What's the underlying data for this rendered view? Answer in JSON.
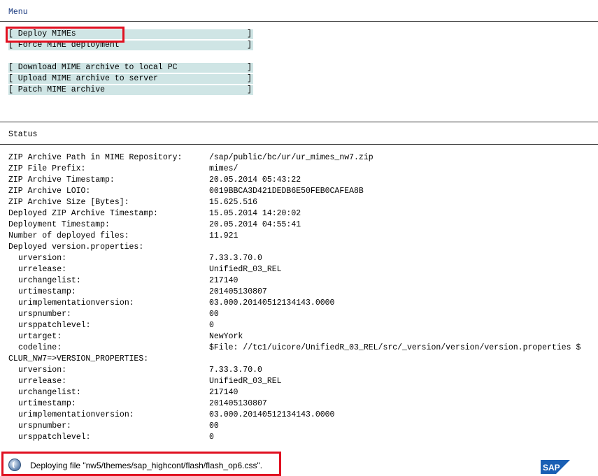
{
  "menu": {
    "title": "Menu",
    "items": [
      {
        "label": "[ Deploy MIMEs",
        "bracket": "]"
      },
      {
        "label": "[ Force MIME deployment",
        "bracket": "]"
      },
      {
        "label": "[ Download MIME archive to local PC",
        "bracket": "]"
      },
      {
        "label": "[ Upload MIME archive to server",
        "bracket": "]"
      },
      {
        "label": "[ Patch MIME archive",
        "bracket": "]"
      }
    ]
  },
  "status": {
    "title": "Status",
    "rows": [
      {
        "key": "ZIP Archive Path in MIME Repository:",
        "value": "/sap/public/bc/ur/ur_mimes_nw7.zip"
      },
      {
        "key": "ZIP File Prefix:",
        "value": "mimes/"
      },
      {
        "key": "ZIP Archive Timestamp:",
        "value": "20.05.2014 05:43:22"
      },
      {
        "key": "ZIP Archive LOIO:",
        "value": "0019BBCA3D421DEDB6E50FEB0CAFEA8B"
      },
      {
        "key": "ZIP Archive Size [Bytes]:",
        "value": "15.625.516"
      },
      {
        "key": "Deployed ZIP Archive Timestamp:",
        "value": "15.05.2014 14:20:02"
      },
      {
        "key": "Deployment Timestamp:",
        "value": "20.05.2014 04:55:41"
      },
      {
        "key": "Number of deployed files:",
        "value": "11.921"
      },
      {
        "key": "Deployed version.properties:",
        "value": ""
      },
      {
        "key": "urversion:",
        "value": "7.33.3.70.0"
      },
      {
        "key": "urrelease:",
        "value": "UnifiedR_03_REL"
      },
      {
        "key": "urchangelist:",
        "value": "217140"
      },
      {
        "key": "urtimestamp:",
        "value": "201405130807"
      },
      {
        "key": "urimplementationversion:",
        "value": "03.000.20140512134143.0000"
      },
      {
        "key": "urspnumber:",
        "value": "00"
      },
      {
        "key": "ursppatchlevel:",
        "value": "0"
      },
      {
        "key": "urtarget:",
        "value": "NewYork"
      },
      {
        "key": "codeline:",
        "value": "$File: //tc1/uicore/UnifiedR_03_REL/src/_version/version/version.properties $"
      },
      {
        "key": "CLUR_NW7=>VERSION_PROPERTIES:",
        "value": ""
      },
      {
        "key": "urversion:",
        "value": "7.33.3.70.0"
      },
      {
        "key": "urrelease:",
        "value": "UnifiedR_03_REL"
      },
      {
        "key": "urchangelist:",
        "value": "217140"
      },
      {
        "key": "urtimestamp:",
        "value": "201405130807"
      },
      {
        "key": "urimplementationversion:",
        "value": "03.000.20140512134143.0000"
      },
      {
        "key": "urspnumber:",
        "value": "00"
      },
      {
        "key": "ursppatchlevel:",
        "value": "0"
      }
    ]
  },
  "statusbar": {
    "message": "Deploying file \"nw5/themes/sap_highcont/flash/flash_op6.css\".",
    "icon": "progress-icon"
  },
  "branding": {
    "logo": "SAP",
    "logo_color": "#1a5fb4"
  },
  "colors": {
    "menu_button_bg": "#cfe5e5",
    "highlight_border": "#e01020",
    "menu_title": "#1a3a80"
  }
}
